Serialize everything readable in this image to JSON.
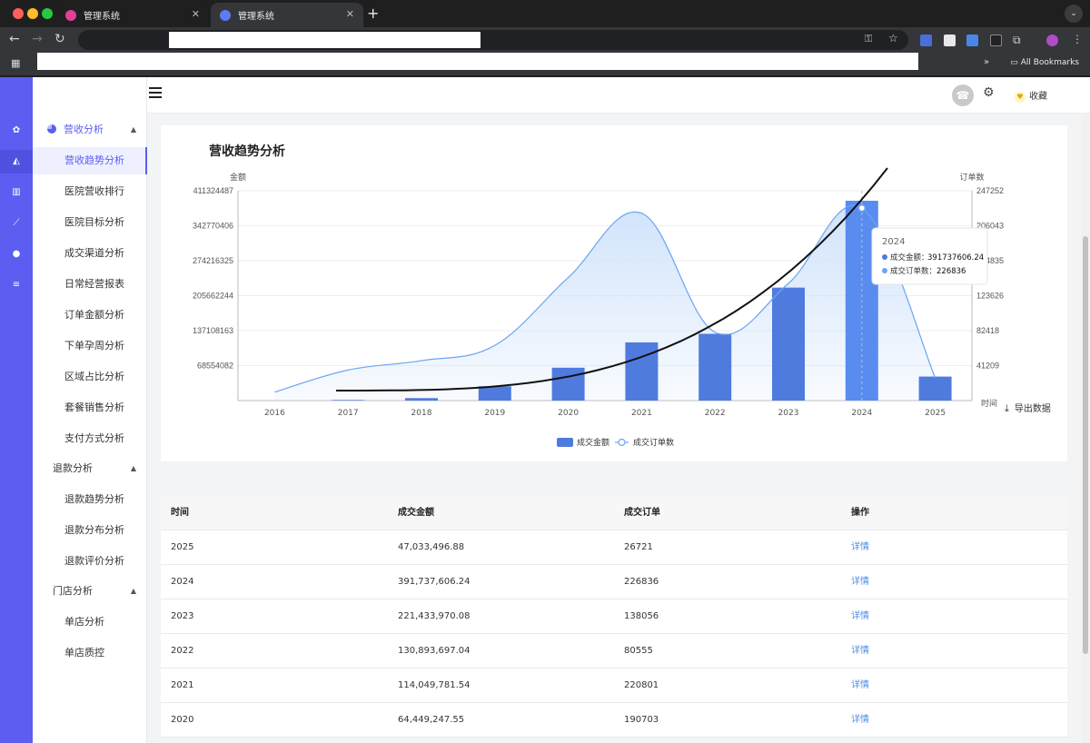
{
  "browser": {
    "tabs": [
      {
        "label": "管理系统"
      },
      {
        "label": "管理系统"
      }
    ],
    "bookmarks_label": "All Bookmarks"
  },
  "sidebar": {
    "groups": [
      {
        "label": "营收分析",
        "items": [
          "营收趋势分析",
          "医院营收排行",
          "医院目标分析",
          "成交渠道分析",
          "日常经营报表",
          "订单金额分析",
          "下单孕周分析",
          "区域占比分析",
          "套餐销售分析",
          "支付方式分析"
        ]
      },
      {
        "label": "退款分析",
        "items": [
          "退款趋势分析",
          "退款分布分析",
          "退款评价分析"
        ]
      },
      {
        "label": "门店分析",
        "items": [
          "单店分析",
          "单店质控"
        ]
      }
    ]
  },
  "header": {
    "favorite_label": "收藏"
  },
  "chart_data": {
    "type": "bar",
    "title": "营收趋势分析",
    "categories": [
      "2016",
      "2017",
      "2018",
      "2019",
      "2020",
      "2021",
      "2022",
      "2023",
      "2024",
      "2025"
    ],
    "xlabel": "时间",
    "y_left_label": "金额",
    "y_right_label": "订单数",
    "y_left_ticks": [
      "68554082",
      "137108163",
      "205662244",
      "274216325",
      "342770406",
      "411324487"
    ],
    "y_right_ticks": [
      "41209",
      "82418",
      "123626",
      "164835",
      "206043",
      "247252"
    ],
    "y_left_lim": [
      0,
      411324487
    ],
    "y_right_lim": [
      0,
      247252
    ],
    "series": [
      {
        "name": "成交金额",
        "type": "bar",
        "values": [
          0,
          1200000,
          4800000,
          28000000,
          64449247.55,
          114049781.54,
          130893697.04,
          221433970.08,
          391737606.24,
          47033496.88
        ]
      },
      {
        "name": "成交订单数",
        "type": "area",
        "values": [
          10000,
          36000,
          47000,
          65000,
          145000,
          220801,
          80555,
          138056,
          226836,
          26721
        ]
      }
    ],
    "legend_position": "bottom",
    "tooltip": {
      "title": "2024",
      "rows": [
        {
          "label": "成交金额：",
          "value": "391737606.24"
        },
        {
          "label": "成交订单数：",
          "value": "226836"
        }
      ]
    },
    "colors": {
      "bar": "#4f7bdf",
      "bar_active": "#5a8cf0",
      "line": "#6aa5f0",
      "area": "#cfe2fb"
    }
  },
  "export_label": "导出数据",
  "table": {
    "columns": [
      "时间",
      "成交金额",
      "成交订单",
      "操作"
    ],
    "rows": [
      {
        "year": "2025",
        "amount": "47,033,496.88",
        "orders": "26721",
        "action": "详情"
      },
      {
        "year": "2024",
        "amount": "391,737,606.24",
        "orders": "226836",
        "action": "详情"
      },
      {
        "year": "2023",
        "amount": "221,433,970.08",
        "orders": "138056",
        "action": "详情"
      },
      {
        "year": "2022",
        "amount": "130,893,697.04",
        "orders": "80555",
        "action": "详情"
      },
      {
        "year": "2021",
        "amount": "114,049,781.54",
        "orders": "220801",
        "action": "详情"
      },
      {
        "year": "2020",
        "amount": "64,449,247.55",
        "orders": "190703",
        "action": "详情"
      }
    ]
  }
}
